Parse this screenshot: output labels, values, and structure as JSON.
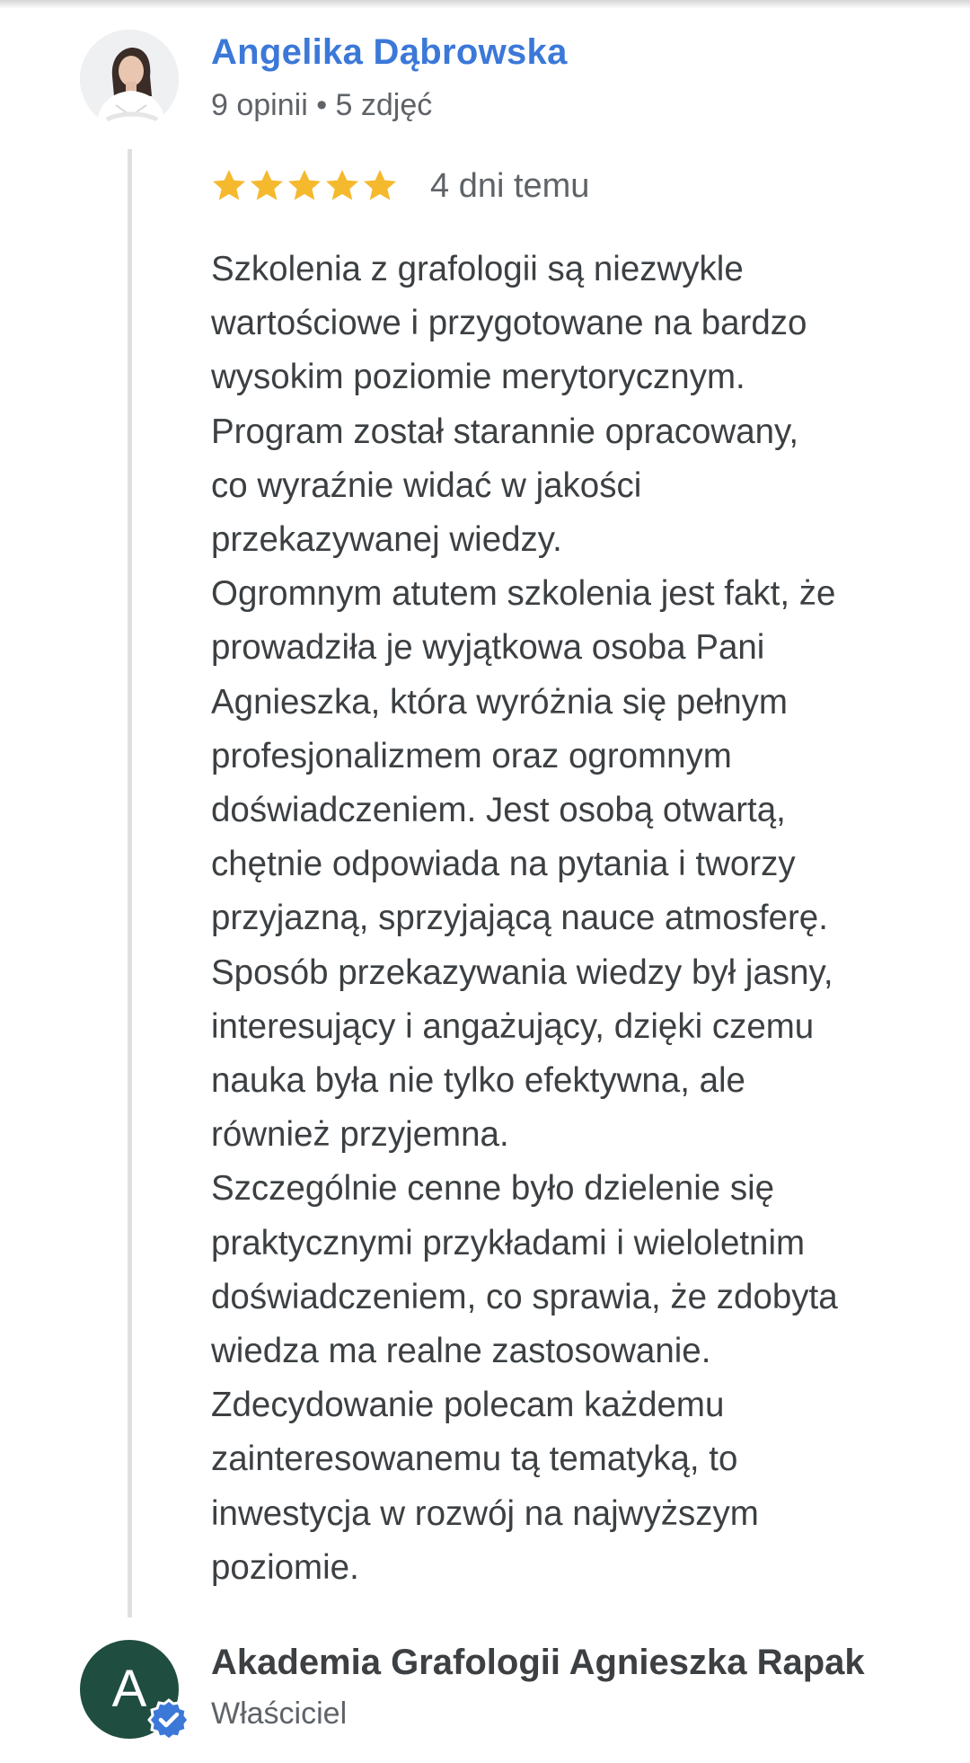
{
  "review": {
    "author": {
      "name": "Angelika Dąbrowska",
      "meta": "9 opinii • 5 zdjęć",
      "avatar": "profile-photo"
    },
    "rating": 5,
    "max_rating": 5,
    "date": "4 dni temu",
    "text_lines": [
      "Szkolenia z grafologii są niezwykle",
      "wartościowe i przygotowane na bardzo",
      "wysokim poziomie merytorycznym.",
      "Program został starannie opracowany,",
      "co wyraźnie widać w jakości",
      "przekazywanej wiedzy.",
      "Ogromnym atutem szkolenia jest fakt, że",
      "prowadziła je wyjątkowa osoba Pani",
      "Agnieszka, która wyróżnia się pełnym",
      "profesjonalizmem oraz ogromnym",
      "doświadczeniem. Jest osobą otwartą,",
      "chętnie odpowiada na pytania i tworzy",
      "przyjazną, sprzyjającą nauce atmosferę.",
      "Sposób przekazywania wiedzy był jasny,",
      "interesujący i angażujący, dzięki czemu",
      "nauka była nie tylko efektywna, ale",
      "również przyjemna.",
      "Szczególnie cenne było dzielenie się",
      "praktycznymi przykładami i wieloletnim",
      "doświadczeniem, co sprawia, że zdobyta",
      "wiedza ma realne zastosowanie.",
      "Zdecydowanie polecam każdemu",
      "zainteresowanemu tą tematyką, to",
      "inwestycja w rozwój na najwyższym",
      "poziomie."
    ]
  },
  "owner_reply": {
    "avatar_letter": "A",
    "name": "Akademia Grafologii Agnieszka Rapak",
    "role": "Właściciel",
    "badge_icon": "verified-check-icon"
  },
  "colors": {
    "author_link": "#3b78d8",
    "star": "#f5b92e",
    "owner_avatar_bg": "#1f4d40",
    "verified_badge": "#3b78d8"
  }
}
